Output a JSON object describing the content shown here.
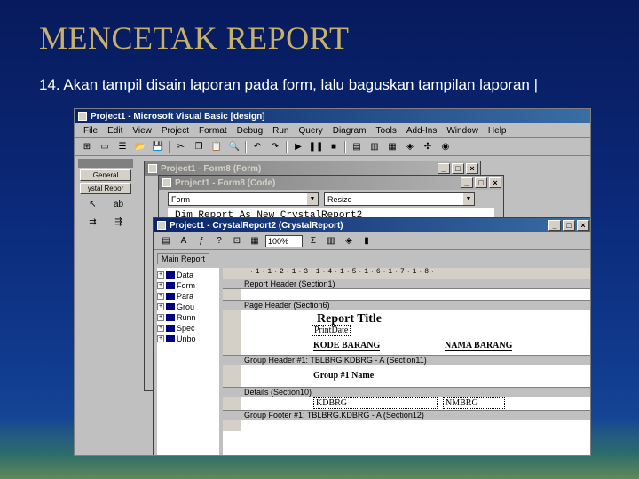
{
  "slide": {
    "title": "MENCETAK  REPORT",
    "bullet": "14. Akan tampil disain laporan pada form, lalu baguskan tampilan laporan |"
  },
  "vb": {
    "title": "Project1 - Microsoft Visual Basic [design]",
    "menu": [
      "File",
      "Edit",
      "View",
      "Project",
      "Format",
      "Debug",
      "Run",
      "Query",
      "Diagram",
      "Tools",
      "Add-Ins",
      "Window",
      "Help"
    ],
    "toolbox_buttons": [
      "General",
      "ystal Repor"
    ],
    "toolbox_tool_label": "ab"
  },
  "form_window": {
    "title": "Project1 - Form8 (Form)"
  },
  "code_window": {
    "title": "Project1 - Form8 (Code)",
    "object_combo": "Form",
    "proc_combo": "Resize",
    "code_line": "Dim Report As New CrystalReport2"
  },
  "crystal_window": {
    "title": "Project1 - CrystalReport2 (CrystalReport)",
    "zoom": "100%",
    "tab": "Main Report",
    "fields": [
      "Data",
      "Form",
      "Para",
      "Grou",
      "Runn",
      "Spec",
      "Unbo"
    ],
    "ruler": "·1·1·2·1·3·1·4·1·5·1·6·1·7·1·8·",
    "sections": {
      "report_header": "Report Header (Section1)",
      "page_header": "Page Header (Section6)",
      "group_header": "Group Header #1: TBLBRG.KDBRG - A (Section11)",
      "details": "Details (Section10)",
      "group_footer": "Group Footer #1: TBLBRG.KDBRG - A (Section12)"
    },
    "objects": {
      "report_title": "Report Title",
      "print_date": "PrintDate",
      "col_kode": "KODE BARANG",
      "col_nama": "NAMA  BARANG",
      "group_name": "Group #1 Name",
      "field_kode": "KDBRG",
      "field_nama": "NMBRG"
    }
  }
}
